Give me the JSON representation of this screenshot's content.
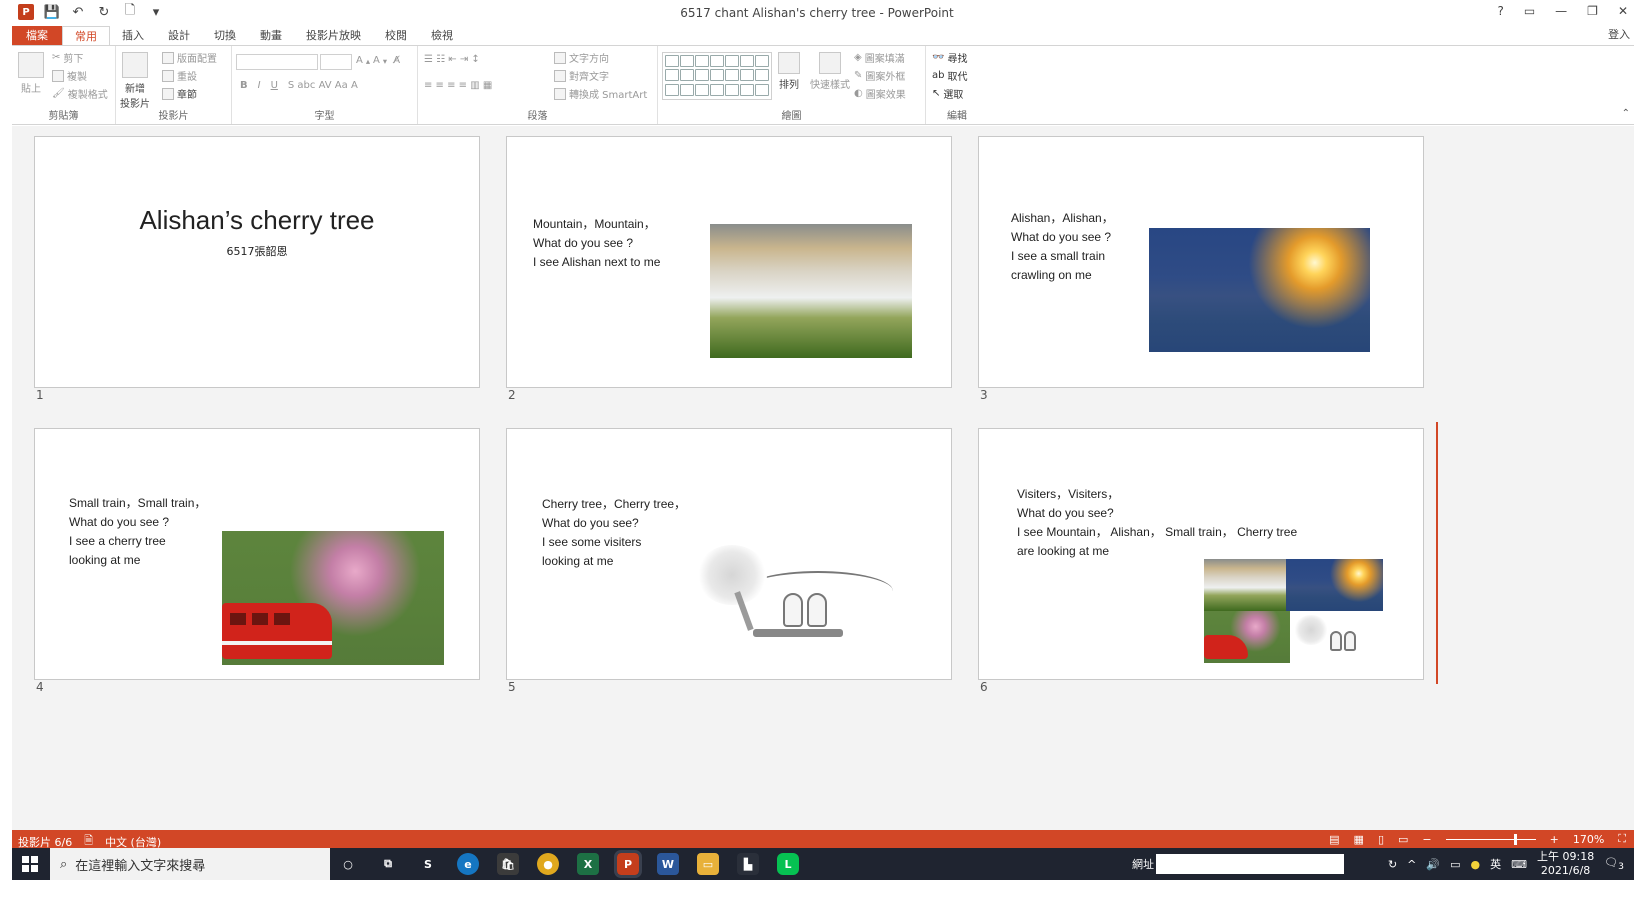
{
  "window": {
    "title": "6517 chant Alishan's cherry tree - PowerPoint",
    "controls": [
      "?",
      "▭",
      "—",
      "❐",
      "✕"
    ],
    "signin": "登入"
  },
  "tabs": [
    "檔案",
    "常用",
    "插入",
    "設計",
    "切換",
    "動畫",
    "投影片放映",
    "校閱",
    "檢視"
  ],
  "ribbon": {
    "clipboard": {
      "paste": "貼上",
      "cut": "剪下",
      "copy": "複製",
      "format_painter": "複製格式",
      "label": "剪貼簿"
    },
    "slides": {
      "new_slide": "新增\n投影片",
      "layout": "版面配置",
      "reset": "重設",
      "section": "章節",
      "label": "投影片"
    },
    "font": {
      "label": "字型"
    },
    "paragraph": {
      "text_direction": "文字方向",
      "align_text": "對齊文字",
      "smartart": "轉換成 SmartArt",
      "label": "段落"
    },
    "drawing": {
      "arrange": "排列",
      "quick_styles": "快速樣式",
      "fill": "圖案填滿",
      "outline": "圖案外框",
      "effects": "圖案效果",
      "label": "繪圖"
    },
    "editing": {
      "find": "尋找",
      "replace": "取代",
      "select": "選取",
      "label": "編輯"
    }
  },
  "slides": [
    {
      "number": "1",
      "title": "Alishan’s cherry tree",
      "subtitle": "6517張韶恩"
    },
    {
      "number": "2",
      "lines": [
        "Mountain，Mountain，",
        "What do you see ?",
        "I see Alishan next to me"
      ]
    },
    {
      "number": "3",
      "lines": [
        "Alishan，Alishan，",
        "What do you see ?",
        "I see a small train",
        " crawling on me"
      ]
    },
    {
      "number": "4",
      "lines": [
        "Small train，Small train，",
        "What do you see ?",
        "I see a cherry tree",
        "looking at me"
      ]
    },
    {
      "number": "5",
      "lines": [
        "Cherry tree，Cherry tree，",
        "What do you see?",
        "I see some visiters",
        "looking at me"
      ]
    },
    {
      "number": "6",
      "lines": [
        "Visiters，Visiters，",
        "What do you see?",
        "I see Mountain，  Alishan，  Small train，  Cherry tree",
        "are looking at me"
      ]
    }
  ],
  "status": {
    "slide_count": "投影片 6/6",
    "language": "中文 (台灣)",
    "zoom": "170%"
  },
  "taskbar": {
    "search_placeholder": "在這裡輸入文字來搜尋",
    "address_label": "網址",
    "ime": "英",
    "time": "上午 09:18",
    "date": "2021/6/8",
    "notifications": "3"
  },
  "colors": {
    "accent": "#d24726",
    "taskbar": "#1f2430"
  }
}
